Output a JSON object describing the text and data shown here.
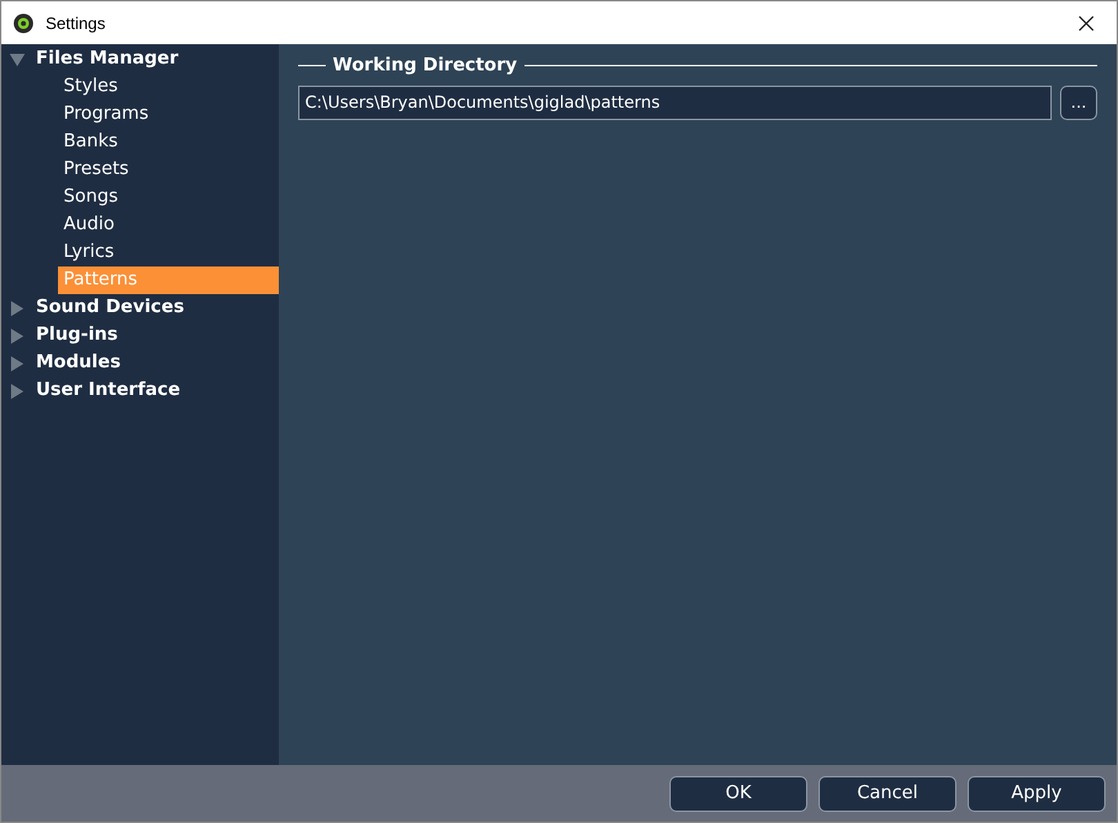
{
  "window": {
    "title": "Settings"
  },
  "tree": [
    {
      "label": "Files Manager",
      "expanded": true,
      "children": [
        {
          "label": "Styles",
          "selected": false
        },
        {
          "label": "Programs",
          "selected": false
        },
        {
          "label": "Banks",
          "selected": false
        },
        {
          "label": "Presets",
          "selected": false
        },
        {
          "label": "Songs",
          "selected": false
        },
        {
          "label": "Audio",
          "selected": false
        },
        {
          "label": "Lyrics",
          "selected": false
        },
        {
          "label": "Patterns",
          "selected": true
        }
      ]
    },
    {
      "label": "Sound Devices",
      "expanded": false
    },
    {
      "label": "Plug-ins",
      "expanded": false
    },
    {
      "label": "Modules",
      "expanded": false
    },
    {
      "label": "User Interface",
      "expanded": false
    }
  ],
  "group": {
    "title": "Working Directory",
    "path": "C:\\Users\\Bryan\\Documents\\giglad\\patterns",
    "browse": "..."
  },
  "buttons": [
    "OK",
    "Cancel",
    "Apply"
  ]
}
